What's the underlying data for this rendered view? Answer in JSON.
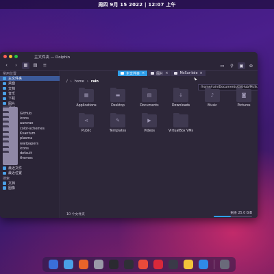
{
  "topbar": {
    "clock": "周四 9月 15 2022 | 12:07 上午"
  },
  "window": {
    "title": "主文件夹 — Dolphin",
    "tabs": [
      {
        "label": "主文件夹",
        "active": true
      },
      {
        "label": "图片",
        "active": false
      },
      {
        "label": "McSur-kde",
        "active": false
      }
    ],
    "tooltip": "/home/rain/Documents/GitHub/McSur-kde",
    "breadcrumb": {
      "root": "/",
      "sep": "›",
      "home": "home",
      "user": "rain"
    }
  },
  "sidebar": {
    "sections": [
      {
        "title": "常用位置",
        "items": [
          {
            "label": "主文件夹",
            "icon": "home-icon",
            "selected": true
          },
          {
            "label": "桌面",
            "icon": "desktop-icon"
          },
          {
            "label": "文档",
            "icon": "documents-icon"
          },
          {
            "label": "音乐",
            "icon": "music-icon"
          },
          {
            "label": "下载",
            "icon": "download-icon"
          },
          {
            "label": "图片",
            "icon": "pictures-icon"
          },
          {
            "label": "视频",
            "icon": "videos-icon"
          },
          {
            "label": "GitHub",
            "icon": "folder-icon"
          },
          {
            "label": "icons",
            "icon": "folder-icon"
          },
          {
            "label": "aurorae",
            "icon": "folder-icon"
          },
          {
            "label": "color-schemes",
            "icon": "folder-icon"
          },
          {
            "label": "Kvantum",
            "icon": "folder-icon"
          },
          {
            "label": "plasma",
            "icon": "folder-icon"
          },
          {
            "label": "wallpapers",
            "icon": "folder-icon"
          },
          {
            "label": "icons",
            "icon": "folder-icon"
          },
          {
            "label": "default",
            "icon": "folder-icon"
          },
          {
            "label": "themes",
            "icon": "folder-icon"
          }
        ]
      },
      {
        "title": "最近位置",
        "items": [
          {
            "label": "最近文件",
            "icon": "recent-files-icon"
          },
          {
            "label": "最近位置",
            "icon": "recent-locations-icon"
          }
        ]
      },
      {
        "title": "搜索",
        "items": [
          {
            "label": "文档",
            "icon": "documents-icon"
          },
          {
            "label": "图像",
            "icon": "image-icon"
          }
        ]
      }
    ]
  },
  "files": [
    {
      "name": "Applications",
      "icon": "applications-folder-icon",
      "glyph": "▦"
    },
    {
      "name": "Desktop",
      "icon": "desktop-folder-icon",
      "glyph": "▬"
    },
    {
      "name": "Documents",
      "icon": "documents-folder-icon",
      "glyph": "▤"
    },
    {
      "name": "Downloads",
      "icon": "downloads-folder-icon",
      "glyph": "↓"
    },
    {
      "name": "Music",
      "icon": "music-folder-icon",
      "glyph": "♪"
    },
    {
      "name": "Pictures",
      "icon": "pictures-folder-icon",
      "glyph": "◙"
    },
    {
      "name": "Public",
      "icon": "public-folder-icon",
      "glyph": "⋖"
    },
    {
      "name": "Templates",
      "icon": "templates-folder-icon",
      "glyph": "✎"
    },
    {
      "name": "Videos",
      "icon": "videos-folder-icon",
      "glyph": "▶"
    },
    {
      "name": "VirtualBox VMs",
      "icon": "folder-icon",
      "glyph": ""
    }
  ],
  "status": {
    "count": "10 个文件夹",
    "free": "剩余 25.0 GiB",
    "used_fraction": 0.45
  },
  "dock": [
    {
      "name": "finder-icon",
      "color": "#3a6ed8"
    },
    {
      "name": "system-settings-icon",
      "color": "#4aa0e6"
    },
    {
      "name": "firefox-icon",
      "color": "#e8642a"
    },
    {
      "name": "chromium-icon",
      "color": "#9a9aa8"
    },
    {
      "name": "github-icon",
      "color": "#2a2a30"
    },
    {
      "name": "terminal-icon",
      "color": "#2f2f36"
    },
    {
      "name": "music-app-icon",
      "color": "#e84a3a"
    },
    {
      "name": "netease-icon",
      "color": "#d8283a"
    },
    {
      "name": "palette-icon",
      "color": "#3a3a48"
    },
    {
      "name": "notes-icon",
      "color": "#f2c43a"
    },
    {
      "name": "app-store-icon",
      "color": "#2f8ae8"
    },
    {
      "name": "trash-icon",
      "color": "#6a6a7a"
    }
  ]
}
